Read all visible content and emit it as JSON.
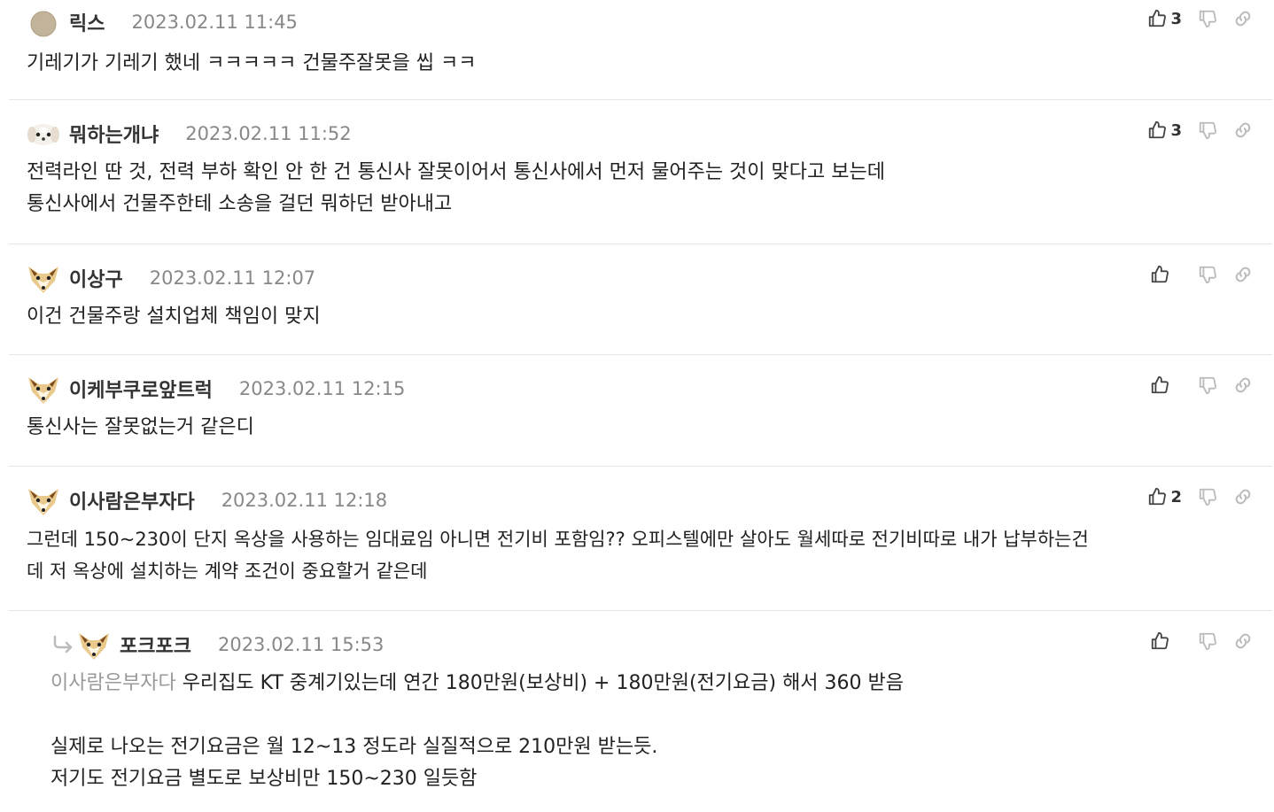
{
  "comments": [
    {
      "nick": "릭스",
      "date": "2023.02.11 11:45",
      "likes": "3",
      "avatar": "plain-circle-avatar",
      "lines": [
        "기레기가 기레기 했네 ㅋㅋㅋㅋㅋ 건물주잘못을 씹 ㅋㅋ"
      ]
    },
    {
      "nick": "뭐하는개냐",
      "date": "2023.02.11 11:52",
      "likes": "3",
      "avatar": "white-dog-avatar",
      "lines": [
        "전력라인 딴 것, 전력 부하 확인 안 한 건 통신사 잘못이어서 통신사에서 먼저 물어주는 것이 맞다고 보는데",
        "통신사에서 건물주한테 소송을 걸던 뭐하던 받아내고"
      ]
    },
    {
      "nick": "이상구",
      "date": "2023.02.11 12:07",
      "likes": "",
      "avatar": "fennec-avatar",
      "lines": [
        "이건 건물주랑 설치업체 책임이 맞지"
      ]
    },
    {
      "nick": "이케부쿠로앞트럭",
      "date": "2023.02.11 12:15",
      "likes": "",
      "avatar": "fennec-avatar",
      "lines": [
        "통신사는 잘못없는거 같은디"
      ]
    },
    {
      "nick": "이사람은부자다",
      "date": "2023.02.11 12:18",
      "likes": "2",
      "avatar": "fennec-avatar",
      "lines": [
        "그런데 150~230이 단지 옥상을 사용하는 임대료임 아니면 전기비 포함임?? 오피스텔에만 살아도 월세따로 전기비따로 내가 납부하는건",
        "데 저 옥상에 설치하는 계약 조건이 중요할거 같은데"
      ]
    }
  ],
  "reply": {
    "nick": "포크포크",
    "date": "2023.02.11 15:53",
    "likes": "",
    "avatar": "fennec-avatar",
    "mention": "이사람은부자다",
    "first_line": "우리집도 KT 중계기있는데 연간 180만원(보상비) + 180만원(전기요금) 해서 360 받음",
    "lines": [
      "실제로 나오는 전기요금은 월 12~13 정도라 실질적으로 210만원 받는듯.",
      "저기도 전기요금 별도로 보상비만 150~230 일듯함"
    ]
  },
  "icons": {
    "like": "thumbs-up-icon",
    "dislike": "thumbs-down-icon",
    "link": "link-icon",
    "reply": "reply-arrow-icon"
  },
  "colors": {
    "icon": "#444444",
    "icon_muted": "#bbbbbb",
    "date": "#888888",
    "mention": "#999999",
    "divider": "#e6e6e6"
  }
}
